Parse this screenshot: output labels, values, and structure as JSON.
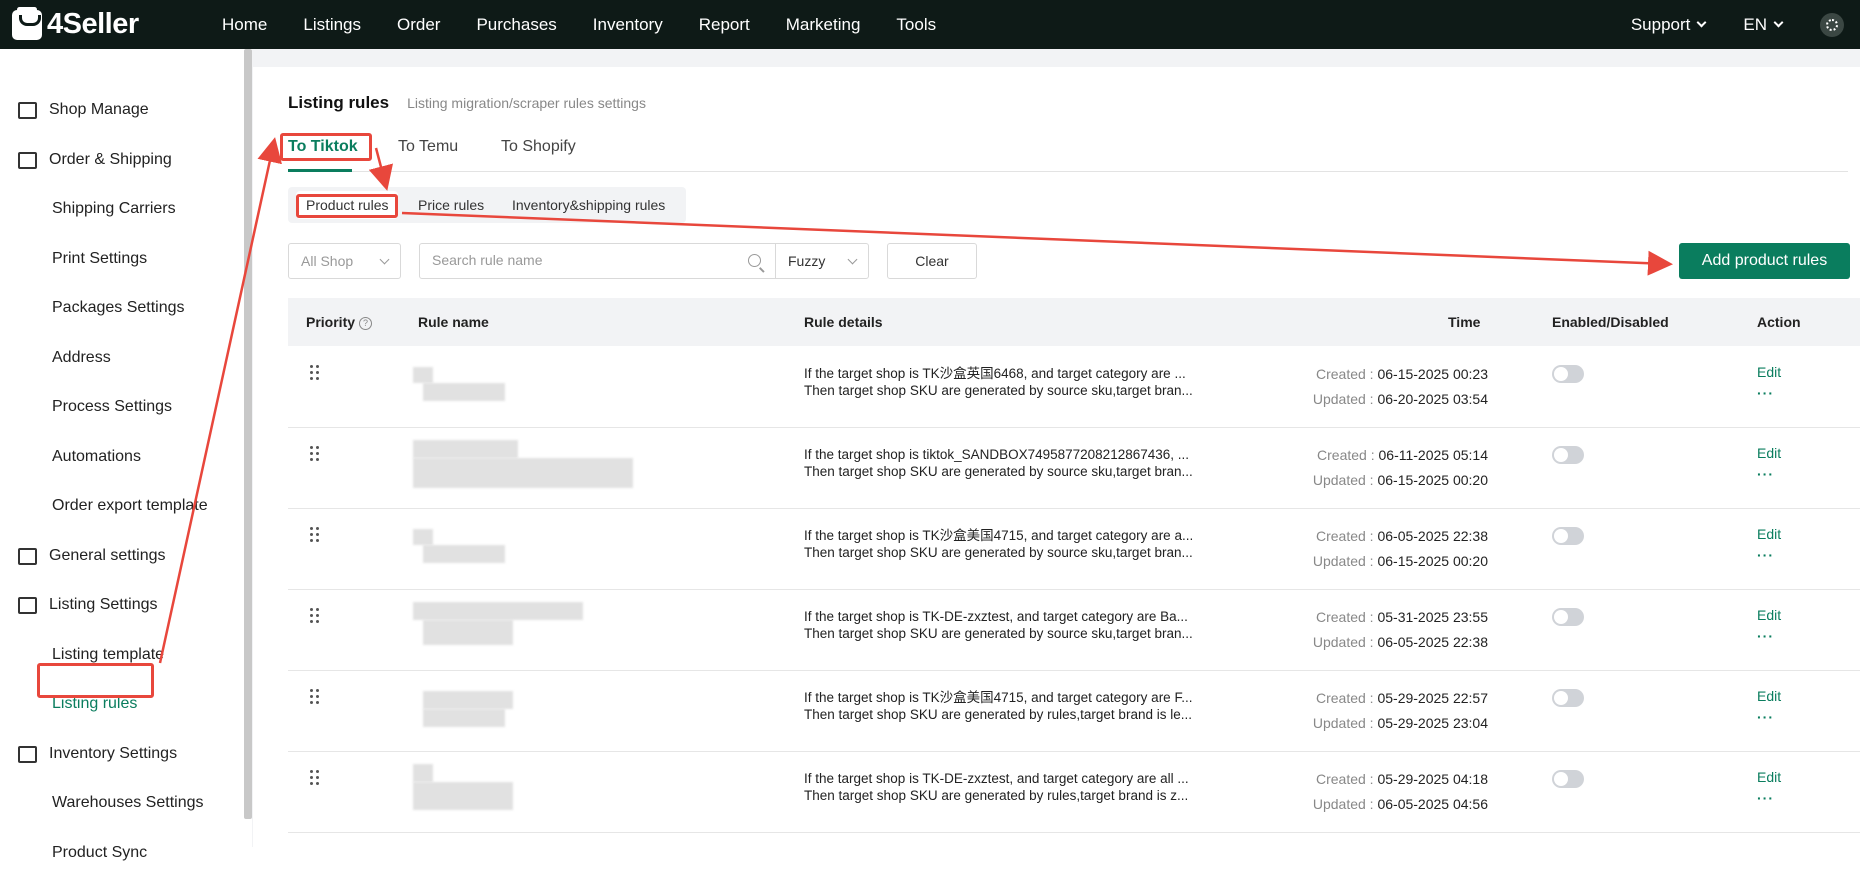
{
  "app": {
    "name": "4Seller"
  },
  "nav": [
    "Home",
    "Listings",
    "Order",
    "Purchases",
    "Inventory",
    "Report",
    "Marketing",
    "Tools"
  ],
  "top_right": {
    "support": "Support",
    "language": "EN"
  },
  "sidebar": {
    "items": [
      {
        "label": "Shop Manage",
        "type": "group",
        "icon": "shop-icon"
      },
      {
        "label": "Order & Shipping",
        "type": "group",
        "icon": "bag-icon"
      },
      {
        "label": "Shipping Carriers",
        "type": "sub"
      },
      {
        "label": "Print Settings",
        "type": "sub"
      },
      {
        "label": "Packages Settings",
        "type": "sub"
      },
      {
        "label": "Address",
        "type": "sub"
      },
      {
        "label": "Process Settings",
        "type": "sub"
      },
      {
        "label": "Automations",
        "type": "sub"
      },
      {
        "label": "Order export template",
        "type": "sub"
      },
      {
        "label": "General settings",
        "type": "group",
        "icon": "printer-icon"
      },
      {
        "label": "Listing Settings",
        "type": "group",
        "icon": "upload-icon"
      },
      {
        "label": "Listing template",
        "type": "sub"
      },
      {
        "label": "Listing rules",
        "type": "sub",
        "active": true
      },
      {
        "label": "Inventory Settings",
        "type": "group",
        "icon": "inventory-icon"
      },
      {
        "label": "Warehouses Settings",
        "type": "sub"
      },
      {
        "label": "Product Sync",
        "type": "sub"
      }
    ]
  },
  "page": {
    "title": "Listing rules",
    "subtitle": "Listing migration/scraper rules settings",
    "tabs": [
      "To Tiktok",
      "To Temu",
      "To Shopify"
    ],
    "subtabs": [
      "Product rules",
      "Price rules",
      "Inventory&shipping rules"
    ]
  },
  "filters": {
    "shop": "All Shop",
    "search_placeholder": "Search rule name",
    "match": "Fuzzy",
    "clear": "Clear",
    "add": "Add product rules"
  },
  "table": {
    "headers": {
      "priority": "Priority",
      "rule_name": "Rule name",
      "rule_details": "Rule details",
      "time": "Time",
      "enabled": "Enabled/Disabled",
      "action": "Action"
    },
    "created_label": "Created :",
    "updated_label": "Updated :",
    "edit_label": "Edit",
    "more_label": "···",
    "rows": [
      {
        "detail1": "If the target shop is TK沙盒英国6468, and target category are ...",
        "detail2": "Then target shop SKU are generated by source sku,target bran...",
        "created": "06-15-2025 00:23",
        "updated": "06-20-2025 03:54"
      },
      {
        "detail1": "If the target shop is tiktok_SANDBOX7495877208212867436, ...",
        "detail2": "Then target shop SKU are generated by source sku,target bran...",
        "created": "06-11-2025 05:14",
        "updated": "06-15-2025 00:20"
      },
      {
        "detail1": "If the target shop is TK沙盒美国4715, and target category are a...",
        "detail2": "Then target shop SKU are generated by source sku,target bran...",
        "created": "06-05-2025 22:38",
        "updated": "06-15-2025 00:20"
      },
      {
        "detail1": "If the target shop is TK-DE-zxztest, and target category are Ba...",
        "detail2": "Then target shop SKU are generated by source sku,target bran...",
        "created": "05-31-2025 23:55",
        "updated": "06-05-2025 22:38"
      },
      {
        "detail1": "If the target shop is TK沙盒美国4715, and target category are F...",
        "detail2": "Then target shop SKU are generated by rules,target brand is le...",
        "created": "05-29-2025 22:57",
        "updated": "05-29-2025 23:04"
      },
      {
        "detail1": "If the target shop is TK-DE-zxztest, and target category are all ...",
        "detail2": "Then target shop SKU are generated by rules,target brand is z...",
        "created": "05-29-2025 04:18",
        "updated": "06-05-2025 04:56"
      }
    ]
  },
  "colors": {
    "accent": "#0a7d5e",
    "topbar": "#0e1a17",
    "annotation": "#e8473c"
  }
}
